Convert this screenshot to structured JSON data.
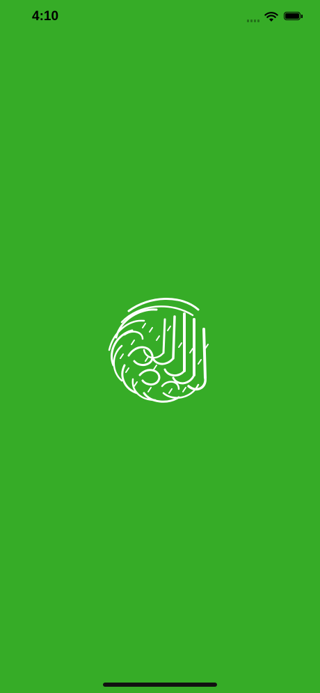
{
  "colors": {
    "background": "#36ac27",
    "emblem": "#ffffff",
    "status_text": "#000000"
  },
  "status_bar": {
    "time": "4:10",
    "signal_icon": "cellular-signal-icon",
    "wifi_icon": "wifi-icon",
    "battery_icon": "battery-icon",
    "battery_level": 1.0
  },
  "splash": {
    "emblem": "quran-calligraphy-logo"
  },
  "home_indicator": "home-indicator-bar"
}
